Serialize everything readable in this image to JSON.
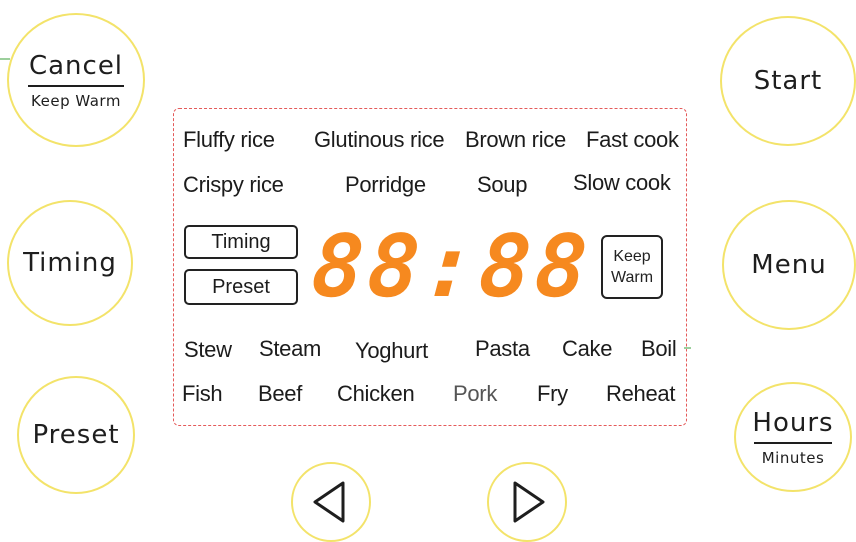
{
  "buttons": {
    "cancel": {
      "label": "Cancel",
      "sub": "Keep Warm"
    },
    "timing": {
      "label": "Timing"
    },
    "preset": {
      "label": "Preset"
    },
    "start": {
      "label": "Start"
    },
    "menu": {
      "label": "Menu"
    },
    "hours": {
      "label": "Hours",
      "sub": "Minutes"
    }
  },
  "panel": {
    "modes_row1": [
      "Fluffy rice",
      "Glutinous rice",
      "Brown rice",
      "Fast cook"
    ],
    "modes_row2": [
      "Crispy rice",
      "Porridge",
      "Soup",
      "Slow cook"
    ],
    "modes_row3": [
      "Stew",
      "Steam",
      "Yoghurt",
      "Pasta",
      "Cake",
      "Boil"
    ],
    "modes_row4": [
      "Fish",
      "Beef",
      "Chicken",
      "Pork",
      "Fry",
      "Reheat"
    ],
    "timing_indicator": "Timing",
    "preset_indicator": "Preset",
    "keep_warm_indicator": {
      "line1": "Keep",
      "line2": "Warm"
    },
    "display": "88:88"
  },
  "nav": {
    "left_icon": "triangle-left-icon",
    "right_icon": "triangle-right-icon"
  },
  "colors": {
    "button_ring": "#f3e36a",
    "panel_border": "#e45a5a",
    "display": "#f6891f"
  }
}
